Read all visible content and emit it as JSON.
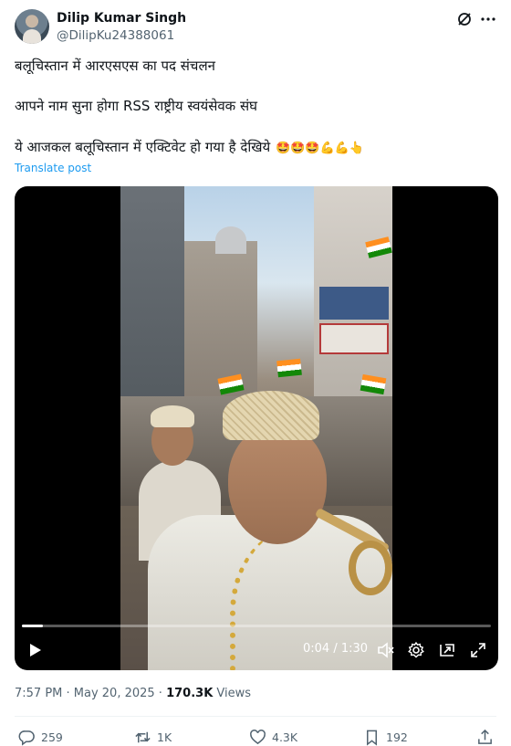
{
  "author": {
    "name": "Dilip Kumar Singh",
    "handle": "@DilipKu24388061"
  },
  "post": {
    "line1": "बलूचिस्तान में आरएसएस का पद संचलन",
    "line2": "आपने नाम सुना होगा RSS राष्ट्रीय स्वयंसेवक संघ",
    "line3": "ये आजकल बलूचिस्तान में एक्टिवेट हो गया है देखिये",
    "emojis": "🤩🤩🤩💪💪👆",
    "translate_label": "Translate post"
  },
  "video": {
    "time_display": "0:04 / 1:30",
    "progress_fraction": 0.044
  },
  "meta": {
    "timestamp": "7:57 PM · May 20, 2025 · ",
    "views_count": "170.3K",
    "views_label": " Views"
  },
  "actions": {
    "replies": "259",
    "reposts": "1K",
    "likes": "4.3K",
    "bookmarks": "192"
  },
  "colors": {
    "link": "#1d9bf0",
    "secondary_text": "#536471",
    "primary_text": "#0f1419"
  },
  "icons": [
    "grok-icon",
    "more-icon",
    "play-icon",
    "mute-icon",
    "settings-icon",
    "pip-icon",
    "fullscreen-icon",
    "reply-icon",
    "retweet-icon",
    "like-icon",
    "bookmark-icon",
    "share-icon"
  ]
}
